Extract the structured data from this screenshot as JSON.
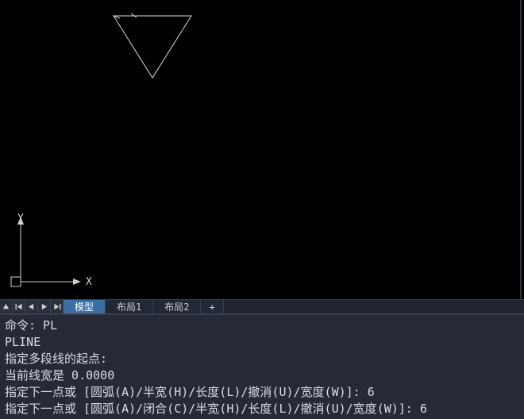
{
  "tabs": {
    "model": "模型",
    "layout1": "布局1",
    "layout2": "布局2",
    "add": "+"
  },
  "ucs": {
    "x_label": "X",
    "y_label": "Y"
  },
  "cmd": {
    "l0": "命令: PL",
    "l1": "PLINE",
    "l2": "指定多段线的起点:",
    "l3_prefix": "当前线宽是 ",
    "l3_value": "0.0000",
    "l4_prefix": "指定下一点或 [圆弧(A)/半宽(H)/长度(L)/撤消(U)/宽度(W)]: ",
    "l4_value": "6",
    "l5_prefix": "指定下一点或 [圆弧(A)/闭合(C)/半宽(H)/长度(L)/撤消(U)/宽度(W)]: ",
    "l5_value": "6"
  }
}
